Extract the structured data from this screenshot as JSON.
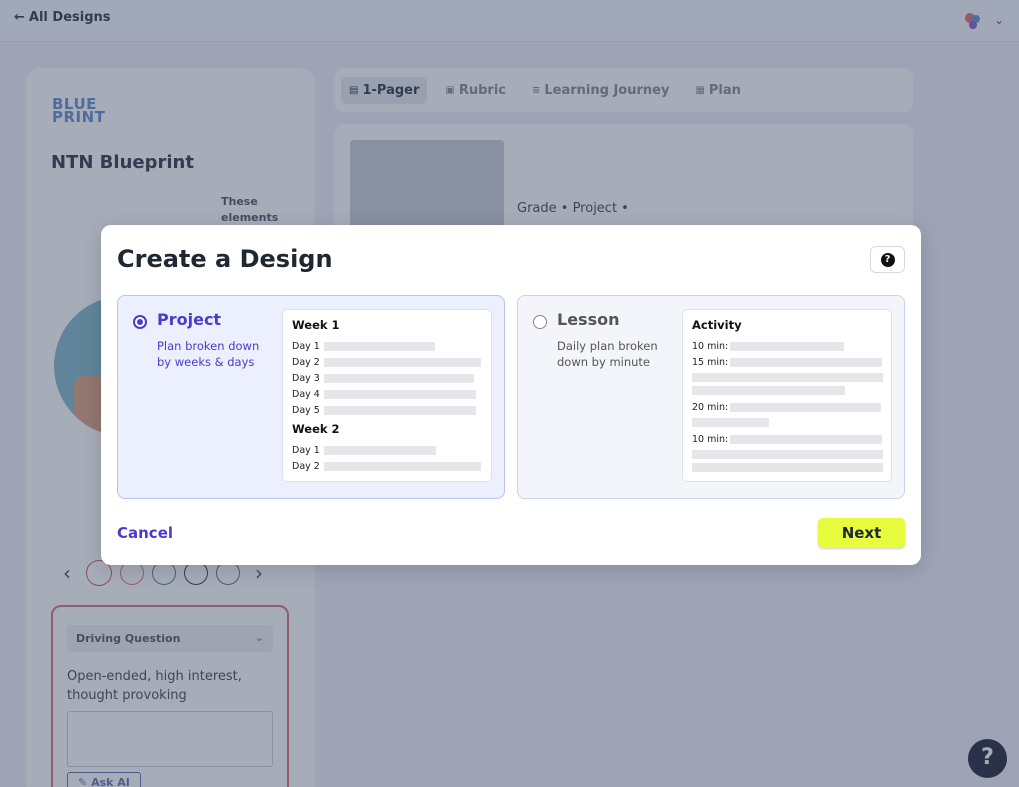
{
  "topbar": {
    "back_label": "All Designs"
  },
  "left_panel": {
    "logo_text": "BLUE PRINT",
    "title": "NTN Blueprint",
    "elements_note": "These elements",
    "driving_question": {
      "select_value": "Driving Question",
      "hint": "Open-ended, high interest, thought provoking",
      "ask_ai_label": "Ask AI"
    }
  },
  "tabs": [
    {
      "label": "1-Pager",
      "icon": "document-icon"
    },
    {
      "label": "Rubric",
      "icon": "rubric-icon"
    },
    {
      "label": "Learning Journey",
      "icon": "list-icon"
    },
    {
      "label": "Plan",
      "icon": "calendar-icon"
    }
  ],
  "content": {
    "meta": "Grade  • Project •"
  },
  "modal": {
    "title": "Create a Design",
    "help_icon": "?",
    "options": [
      {
        "name": "Project",
        "description": "Plan broken down by weeks & days",
        "selected": true,
        "preview": {
          "week1_title": "Week 1",
          "week1_days": [
            "Day 1",
            "Day 2",
            "Day 3",
            "Day 4",
            "Day 5"
          ],
          "week2_title": "Week 2",
          "week2_days": [
            "Day 1",
            "Day 2"
          ]
        }
      },
      {
        "name": "Lesson",
        "description": "Daily plan broken down by minute",
        "selected": false,
        "preview": {
          "title": "Activity",
          "times": [
            "10 min:",
            "15 min:",
            "20 min:",
            "10 min:"
          ]
        }
      }
    ],
    "cancel_label": "Cancel",
    "next_label": "Next"
  },
  "help_fab": "?",
  "colors": {
    "accent": "#4a3ccf",
    "next_button": "#e6fc3c",
    "overlay": "#3c4664"
  }
}
